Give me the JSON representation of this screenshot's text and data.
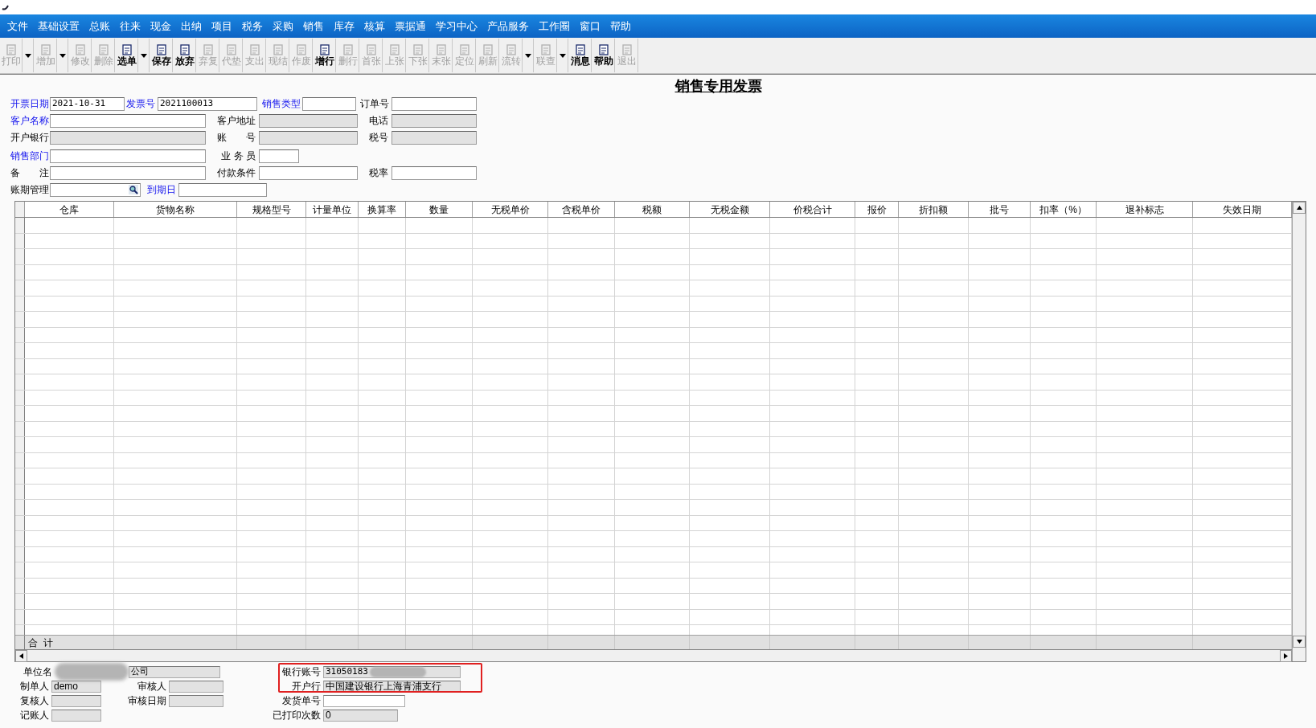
{
  "menu": [
    "文件",
    "基础设置",
    "总账",
    "往来",
    "现金",
    "出纳",
    "项目",
    "税务",
    "采购",
    "销售",
    "库存",
    "核算",
    "票据通",
    "学习中心",
    "产品服务",
    "工作圈",
    "窗口",
    "帮助"
  ],
  "toolbar": [
    {
      "label": "打印",
      "disabled": true,
      "dropdown": true
    },
    {
      "label": "增加",
      "disabled": true,
      "dropdown": true
    },
    {
      "label": "修改",
      "disabled": true,
      "dropdown": false
    },
    {
      "label": "删除",
      "disabled": true,
      "dropdown": false
    },
    {
      "label": "选单",
      "disabled": false,
      "dropdown": true
    },
    {
      "label": "保存",
      "disabled": false,
      "dropdown": false
    },
    {
      "label": "放弃",
      "disabled": false,
      "dropdown": false
    },
    {
      "label": "弃复",
      "disabled": true,
      "dropdown": false
    },
    {
      "label": "代垫",
      "disabled": true,
      "dropdown": false
    },
    {
      "label": "支出",
      "disabled": true,
      "dropdown": false
    },
    {
      "label": "现结",
      "disabled": true,
      "dropdown": false
    },
    {
      "label": "作废",
      "disabled": true,
      "dropdown": false
    },
    {
      "label": "增行",
      "disabled": false,
      "dropdown": false
    },
    {
      "label": "删行",
      "disabled": true,
      "dropdown": false
    },
    {
      "label": "首张",
      "disabled": true,
      "dropdown": false
    },
    {
      "label": "上张",
      "disabled": true,
      "dropdown": false
    },
    {
      "label": "下张",
      "disabled": true,
      "dropdown": false
    },
    {
      "label": "末张",
      "disabled": true,
      "dropdown": false
    },
    {
      "label": "定位",
      "disabled": true,
      "dropdown": false
    },
    {
      "label": "刷新",
      "disabled": true,
      "dropdown": false
    },
    {
      "label": "流转",
      "disabled": true,
      "dropdown": true
    },
    {
      "label": "联查",
      "disabled": true,
      "dropdown": true
    },
    {
      "label": "消息",
      "disabled": false,
      "dropdown": false
    },
    {
      "label": "帮助",
      "disabled": false,
      "dropdown": false
    },
    {
      "label": "退出",
      "disabled": true,
      "dropdown": false
    }
  ],
  "title": "销售专用发票",
  "form": [
    [
      {
        "label": "开票日期",
        "link": true,
        "value": "2021-10-31",
        "disabled": false
      },
      {
        "label": "发票号",
        "link": true,
        "value": "2021100013",
        "disabled": false
      },
      {
        "label": "销售类型",
        "link": true,
        "disabled": false
      },
      {
        "label": "订单号",
        "link": false,
        "disabled": false
      }
    ],
    [
      {
        "label": "客户名称",
        "link": true,
        "disabled": false
      },
      {
        "label": "客户地址",
        "link": false,
        "disabled": true
      },
      {
        "label": "电话",
        "link": false,
        "disabled": true
      }
    ],
    [
      {
        "label": "开户银行",
        "link": false,
        "disabled": true
      },
      {
        "label": "账　　号",
        "link": false,
        "disabled": true
      },
      {
        "label": "税号",
        "link": false,
        "disabled": true
      }
    ],
    [
      {
        "label": "销售部门",
        "link": true,
        "disabled": false
      },
      {
        "label": "业 务 员",
        "link": false,
        "disabled": false
      }
    ],
    [
      {
        "label": "备　　注",
        "link": false,
        "disabled": false
      },
      {
        "label": "付款条件",
        "link": false,
        "disabled": false
      },
      {
        "label": "税率",
        "link": false,
        "disabled": false
      }
    ],
    [
      {
        "label": "账期管理",
        "link": false,
        "disabled": false,
        "lookup": true
      },
      {
        "label": "到期日",
        "link": true,
        "disabled": false
      }
    ]
  ],
  "table": {
    "columns": [
      "仓库",
      "货物名称",
      "规格型号",
      "计量单位",
      "换算率",
      "数量",
      "无税单价",
      "含税单价",
      "税额",
      "无税金额",
      "价税合计",
      "报价",
      "折扣额",
      "批号",
      "扣率（%）",
      "退补标志",
      "失效日期"
    ],
    "total_label": "合  计"
  },
  "footer": {
    "left": [
      [
        {
          "label": "单位名",
          "value": "公司",
          "disabled": true,
          "blurred": true
        }
      ],
      [
        {
          "label": "制单人",
          "value": "demo",
          "disabled": true
        },
        {
          "label": "审核人",
          "disabled": true
        }
      ],
      [
        {
          "label": "复核人",
          "disabled": true
        },
        {
          "label": "审核日期",
          "disabled": true
        }
      ],
      [
        {
          "label": "记账人",
          "disabled": true
        }
      ]
    ],
    "right": [
      {
        "label": "银行账号",
        "value": "31050183",
        "disabled": true,
        "blurred": true
      },
      {
        "label": "开户行",
        "value": "中国建设银行上海青浦支行",
        "disabled": true
      },
      {
        "label": "发货单号",
        "disabled": false
      },
      {
        "label": "已打印次数",
        "value": "0",
        "disabled": true
      }
    ]
  }
}
